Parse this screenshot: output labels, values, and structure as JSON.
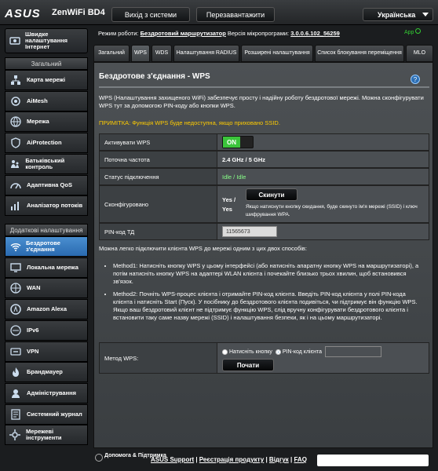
{
  "header": {
    "logo": "ASUS",
    "model": "ZenWiFi BD4",
    "logout": "Вихід з системи",
    "reboot": "Перезавантажити",
    "language": "Українська"
  },
  "status_bar": {
    "mode_label": "Режим роботи:",
    "mode_value": "Бездротовий маршрутизатор",
    "fw_label": "Версія мікропрограми:",
    "fw_value": "3.0.0.6.102_56259",
    "app_label": "App"
  },
  "sidebar": {
    "qis": "Швидке налаштування Інтернет",
    "general_header": "Загальний",
    "general": [
      {
        "label": "Карта мережі",
        "icon": "network-map-icon"
      },
      {
        "label": "AiMesh",
        "icon": "aimesh-icon"
      },
      {
        "label": "Мережа",
        "icon": "network-icon"
      },
      {
        "label": "AiProtection",
        "icon": "aiprotection-icon"
      },
      {
        "label": "Батьківський контроль",
        "icon": "parental-control-icon"
      },
      {
        "label": "Адаптивна QoS",
        "icon": "qos-icon"
      },
      {
        "label": "Аналізатор потоків",
        "icon": "traffic-analyzer-icon"
      }
    ],
    "advanced_header": "Додаткові налаштування",
    "advanced": [
      {
        "label": "Бездротове з'єднання",
        "icon": "wireless-icon"
      },
      {
        "label": "Локальна мережа",
        "icon": "lan-icon"
      },
      {
        "label": "WAN",
        "icon": "wan-icon"
      },
      {
        "label": "Amazon Alexa",
        "icon": "alexa-icon"
      },
      {
        "label": "IPv6",
        "icon": "ipv6-icon"
      },
      {
        "label": "VPN",
        "icon": "vpn-icon"
      },
      {
        "label": "Брандмауер",
        "icon": "firewall-icon"
      },
      {
        "label": "Адміністрування",
        "icon": "admin-icon"
      },
      {
        "label": "Системний журнал",
        "icon": "syslog-icon"
      },
      {
        "label": "Мережеві інструменти",
        "icon": "tools-icon"
      }
    ]
  },
  "tabs": [
    "Загальний",
    "WPS",
    "WDS",
    "Налаштування RADIUS",
    "Розширені налаштування",
    "Список блокування переміщення",
    "MLO"
  ],
  "main": {
    "title": "Бездротове з'єднання - WPS",
    "description": "WPS (Налаштування захищеного WiFi) забезпечує просту і надійну роботу бездротової мережі. Можна сконфігурувати WPS тут за допомогою PIN-коду або кнопки WPS.",
    "note": "ПРИМІТКА: Функція WPS буде недоступна, якщо приховано SSID.",
    "rows": {
      "enable_label": "Активувати WPS",
      "enable_value": "ON",
      "freq_label": "Поточна частота",
      "freq_value": "2.4 GHz / 5 GHz",
      "conn_label": "Статус підключення",
      "conn_value": "Idle / Idle",
      "config_label": "Сконфігуровано",
      "config_value": "Yes / Yes",
      "reset_btn": "Скинути",
      "reset_note": "Якщо натиснути кнопку скидання, буде скинуто ім'я мережі (SSID) і ключ шифрування WPA.",
      "pin_label": "PIN-код ТД",
      "pin_value": "11565673"
    },
    "intro": "Можна легко підключити клієнта WPS до мережі одним з цих двох способів:",
    "method1": "Method1: Натисніть кнопку WPS у цьому інтерфейсі (або натисніть апаратну кнопку WPS на маршрутизаторі), а потім натисніть кнопку WPS на адаптері WLAN клієнта і почекайте близько трьох хвилин, щоб встановився зв'язок.",
    "method2": "Method2: Почніть WPS-процес клієнта і отримайте PIN-код клієнта. Введіть PIN-код клієнта у полі PIN-кода клієнта і натисніть Start (Пуск). У посібнику до бездротового клієнта подивіться, чи підтримує він функцію WPS. Якщо ваш бездротовий клієнт не підтримує функцію WPS, слід вручну конфігурувати бездротового клієнта і встановити таку саме назву мережі (SSID) і налаштування безпеки, як і на цьому маршрутизаторі.",
    "method_label": "Метод WPS:",
    "opt_push": "Натисніть кнопку",
    "opt_pin": "PIN-код клієнта",
    "start_btn": "Почати"
  },
  "footer": {
    "help": "Допомога & Підтримка",
    "support": "ASUS Support",
    "register": "Реєстрація продукту",
    "feedback": "Відгук",
    "faq": "FAQ"
  }
}
